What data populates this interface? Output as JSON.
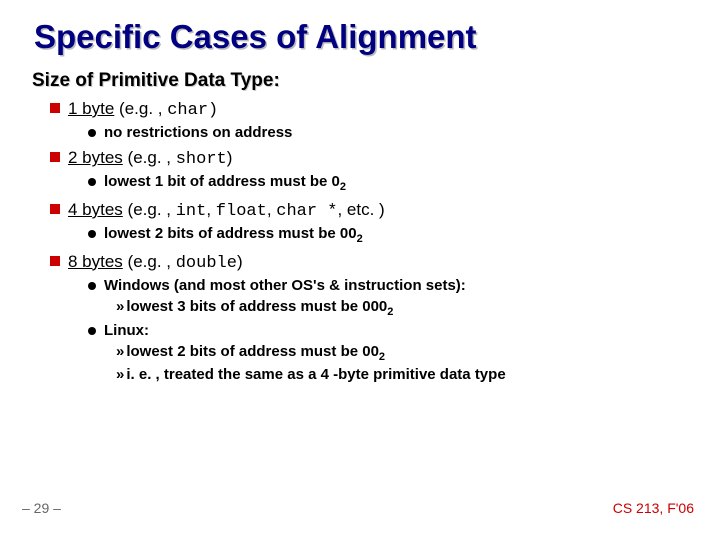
{
  "title": "Specific Cases of Alignment",
  "subtitle": "Size of Primitive Data Type:",
  "items": [
    {
      "head_u": "1 byte",
      "head_rest": " (e.g. , ",
      "head_mono": "char)",
      "head_tail": "",
      "subs": [
        {
          "type": "dot",
          "text": "no restrictions on address"
        }
      ]
    },
    {
      "head_u": "2 bytes",
      "head_rest": " (e.g. , ",
      "head_mono": "short",
      "head_tail": ")",
      "subs": [
        {
          "type": "dot",
          "text_pre": "lowest 1 bit of address must be 0",
          "sub": "2"
        }
      ]
    },
    {
      "head_u": "4 bytes",
      "head_rest": " (e.g. , ",
      "head_mono": "int",
      "head_mid1": ", ",
      "head_mono2": "float",
      "head_mid2": ", ",
      "head_mono3": "char *",
      "head_tail": ", etc. )",
      "subs": [
        {
          "type": "dot",
          "text_pre": "lowest 2 bits of address must be 00",
          "sub": "2"
        }
      ]
    },
    {
      "head_u": "8 bytes",
      "head_rest": " (e.g. , ",
      "head_mono": "double",
      "head_tail": ")",
      "subs": [
        {
          "type": "dot",
          "text": "Windows (and most other OS's & instruction sets):"
        },
        {
          "type": "raquo",
          "text_pre": "lowest 3 bits of address must be 000",
          "sub": "2"
        },
        {
          "type": "dot",
          "text": "Linux:"
        },
        {
          "type": "raquo",
          "text_pre": "lowest 2 bits of address must be 00",
          "sub": "2"
        },
        {
          "type": "raquo",
          "text": "i. e. , treated the same as a 4 -byte primitive data type"
        }
      ]
    }
  ],
  "footer": {
    "left": "– 29 –",
    "right": "CS 213, F'06"
  }
}
